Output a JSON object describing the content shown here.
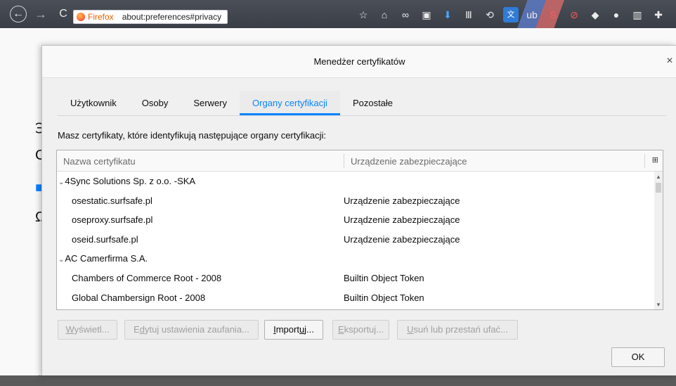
{
  "browser": {
    "back_glyph": "←",
    "forward_glyph": "→",
    "reload_glyph": "C",
    "identity_label": "Firefox",
    "url": "about:preferences#privacy",
    "toolbar_icons": [
      {
        "name": "bookmark-star-icon",
        "glyph": "☆"
      },
      {
        "name": "home-icon",
        "glyph": "⌂"
      },
      {
        "name": "infinity-icon",
        "glyph": "∞"
      },
      {
        "name": "print-icon",
        "glyph": "▣"
      },
      {
        "name": "download-icon",
        "glyph": "⬇"
      },
      {
        "name": "library-icon",
        "glyph": "Ⅲ"
      },
      {
        "name": "history-icon",
        "glyph": "⟲"
      },
      {
        "name": "translate-icon",
        "glyph": "文"
      },
      {
        "name": "ublock-icon",
        "glyph": "ub"
      },
      {
        "name": "skype-icon",
        "glyph": "S"
      },
      {
        "name": "block-icon",
        "glyph": "⊘"
      },
      {
        "name": "paint-icon",
        "glyph": "◆"
      },
      {
        "name": "puzzle-ghost-icon",
        "glyph": "●"
      },
      {
        "name": "reader-icon",
        "glyph": "▥"
      },
      {
        "name": "extensions-icon",
        "glyph": "✚"
      }
    ]
  },
  "page_behind": {
    "glyph_1": "℈",
    "glyph_2": "C",
    "glyph_3": "■",
    "glyph_4": "Ω",
    "glyph_5": "ⓘ"
  },
  "dialog": {
    "title": "Menedżer certyfikatów",
    "close_glyph": "×",
    "tabs": [
      {
        "label": "Użytkownik",
        "selected": false
      },
      {
        "label": "Osoby",
        "selected": false
      },
      {
        "label": "Serwery",
        "selected": false
      },
      {
        "label": "Organy certyfikacji",
        "selected": true
      },
      {
        "label": "Pozostałe",
        "selected": false
      }
    ],
    "intro_text": "Masz certyfikaty, które identyfikują następujące organy certyfikacji:",
    "columns": {
      "name": "Nazwa certyfikatu",
      "device": "Urządzenie zabezpieczające",
      "picker_glyph": "⊞"
    },
    "rows": [
      {
        "type": "group",
        "name": "4Sync Solutions Sp. z o.o. -SKA",
        "device": ""
      },
      {
        "type": "child",
        "name": "osestatic.surfsafe.pl",
        "device": "Urządzenie zabezpieczające"
      },
      {
        "type": "child",
        "name": "oseproxy.surfsafe.pl",
        "device": "Urządzenie zabezpieczające"
      },
      {
        "type": "child",
        "name": "oseid.surfsafe.pl",
        "device": "Urządzenie zabezpieczające"
      },
      {
        "type": "group",
        "name": "AC Camerfirma S.A.",
        "device": ""
      },
      {
        "type": "child",
        "name": "Chambers of Commerce Root - 2008",
        "device": "Builtin Object Token"
      },
      {
        "type": "child",
        "name": "Global Chambersign Root - 2008",
        "device": "Builtin Object Token"
      }
    ],
    "twisty_glyph": "⌄",
    "scroll_up_glyph": "▴",
    "scroll_down_glyph": "▾",
    "buttons": {
      "view_u": "W",
      "view_rest": "yświetl...",
      "edit_pre": "E",
      "edit_u": "d",
      "edit_rest": "ytuj ustawienia zaufania...",
      "import_u": "I",
      "import_mid": "mport",
      "import_u2": "u",
      "import_rest": "j...",
      "export_u": "E",
      "export_rest": "ksportuj...",
      "delete_u": "U",
      "delete_rest": "suń lub przestań ufać...",
      "ok": "OK"
    }
  }
}
